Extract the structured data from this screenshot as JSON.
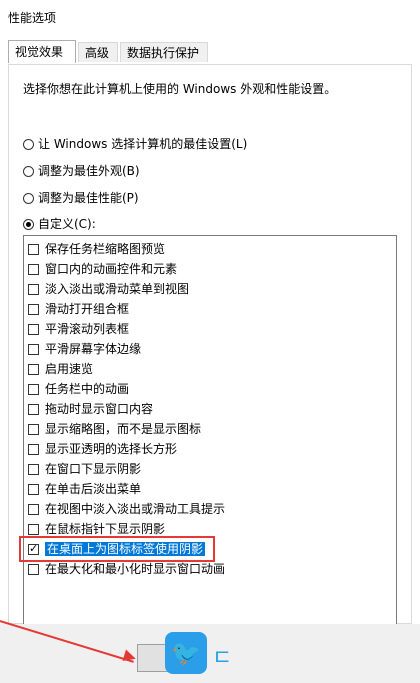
{
  "window": {
    "title": "性能选项"
  },
  "tabs": [
    {
      "label": "视觉效果"
    },
    {
      "label": "高级"
    },
    {
      "label": "数据执行保护"
    }
  ],
  "description": "选择你想在此计算机上使用的 Windows 外观和性能设置。",
  "radios": [
    {
      "label": "让 Windows 选择计算机的最佳设置(L)",
      "checked": false
    },
    {
      "label": "调整为最佳外观(B)",
      "checked": false
    },
    {
      "label": "调整为最佳性能(P)",
      "checked": false
    },
    {
      "label": "自定义(C):",
      "checked": true
    }
  ],
  "options": [
    {
      "label": "保存任务栏缩略图预览",
      "checked": false
    },
    {
      "label": "窗口内的动画控件和元素",
      "checked": false
    },
    {
      "label": "淡入淡出或滑动菜单到视图",
      "checked": false
    },
    {
      "label": "滑动打开组合框",
      "checked": false
    },
    {
      "label": "平滑滚动列表框",
      "checked": false
    },
    {
      "label": "平滑屏幕字体边缘",
      "checked": false
    },
    {
      "label": "启用速览",
      "checked": false
    },
    {
      "label": "任务栏中的动画",
      "checked": false
    },
    {
      "label": "拖动时显示窗口内容",
      "checked": false
    },
    {
      "label": "显示缩略图，而不是显示图标",
      "checked": false
    },
    {
      "label": "显示亚透明的选择长方形",
      "checked": false
    },
    {
      "label": "在窗口下显示阴影",
      "checked": false
    },
    {
      "label": "在单击后淡出菜单",
      "checked": false
    },
    {
      "label": "在视图中淡入淡出或滑动工具提示",
      "checked": false
    },
    {
      "label": "在鼠标指针下显示阴影",
      "checked": false
    },
    {
      "label": "在桌面上为图标标签使用阴影",
      "checked": true
    },
    {
      "label": "在最大化和最小化时显示窗口动画",
      "checked": false
    }
  ],
  "colors": {
    "selection": "#0078d7",
    "annotation": "#e53935"
  },
  "icons": {
    "bottom_logo": "twitter-bird-icon"
  }
}
